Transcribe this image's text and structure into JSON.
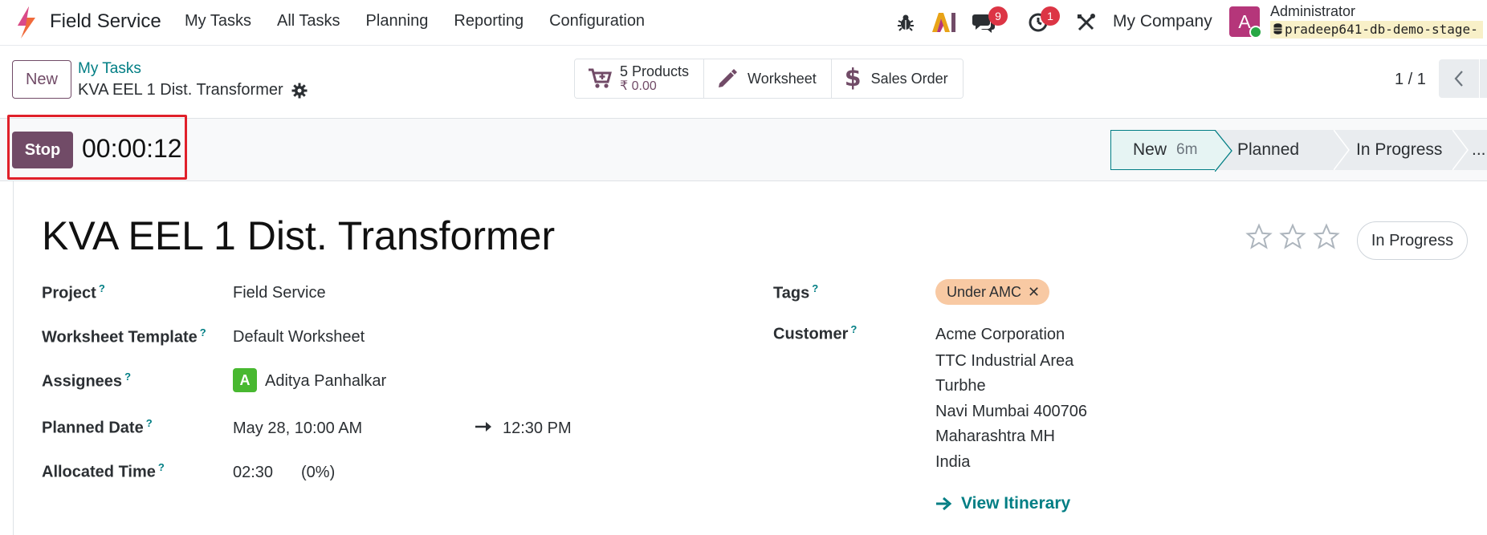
{
  "navbar": {
    "app_name": "Field Service",
    "menu": [
      "My Tasks",
      "All Tasks",
      "Planning",
      "Reporting",
      "Configuration"
    ],
    "messages_count": "9",
    "activities_count": "1",
    "company": "My Company",
    "avatar_letter": "A",
    "user_name": "Administrator",
    "database": "pradeep641-db-demo-stage-"
  },
  "control": {
    "new_label": "New",
    "breadcrumb": "My Tasks",
    "record_name": "KVA EEL 1 Dist. Transformer",
    "products_label": "5 Products",
    "products_amount": "₹ 0.00",
    "worksheet_label": "Worksheet",
    "sales_order_label": "Sales Order",
    "pager": "1 / 1"
  },
  "statusbar": {
    "stop_label": "Stop",
    "timer": "00:00:12",
    "stages": [
      {
        "label": "New",
        "duration": "6m",
        "active": true
      },
      {
        "label": "Planned"
      },
      {
        "label": "In Progress"
      },
      {
        "label": "..."
      }
    ]
  },
  "form": {
    "title": "KVA EEL 1 Dist. Transformer",
    "priority_stars": 0,
    "state": "In Progress",
    "help_mark": "?",
    "project_label": "Project",
    "project": "Field Service",
    "worksheet_template_label": "Worksheet Template",
    "worksheet_template": "Default Worksheet",
    "assignees_label": "Assignees",
    "assignee_letter": "A",
    "assignee": "Aditya Panhalkar",
    "planned_date_label": "Planned Date",
    "planned_start": "May 28, 10:00 AM",
    "planned_end": "12:30 PM",
    "allocated_time_label": "Allocated Time",
    "allocated_time": "02:30",
    "allocated_percent": "(0%)",
    "tags_label": "Tags",
    "tag": "Under AMC",
    "customer_label": "Customer",
    "customer_lines": [
      "Acme Corporation",
      "TTC Industrial Area",
      "Turbhe",
      "Navi Mumbai 400706",
      "Maharashtra MH",
      "India"
    ],
    "view_itinerary": "View Itinerary"
  },
  "colors": {
    "brand": "#714b67",
    "teal": "#017e84",
    "highlight": "#e0202a",
    "tag_bg": "#f8c9a3"
  }
}
